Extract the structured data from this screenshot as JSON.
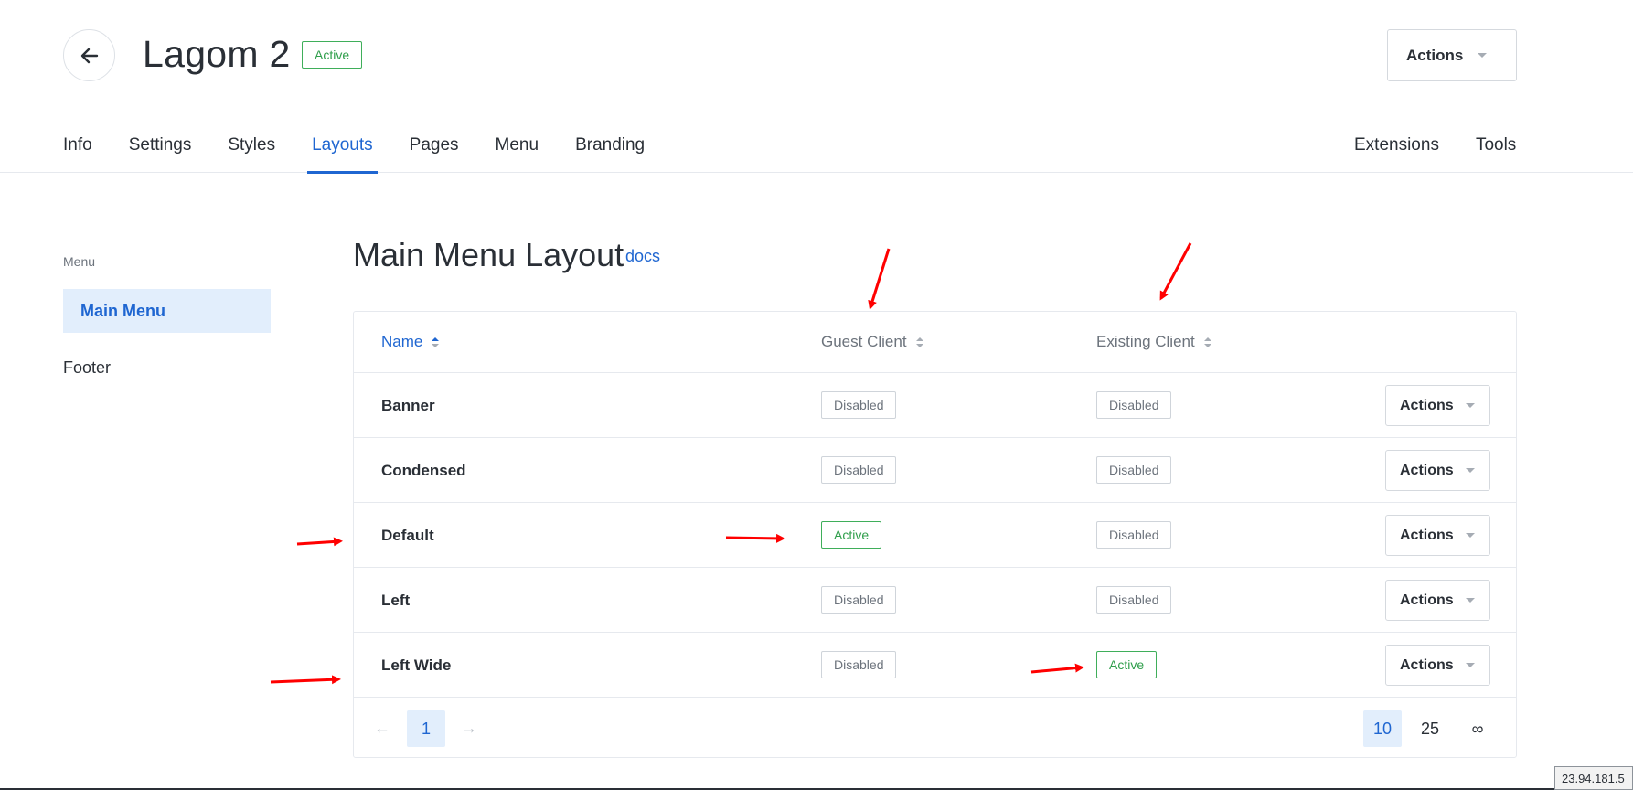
{
  "header": {
    "title": "Lagom 2",
    "status": "Active",
    "actions_label": "Actions"
  },
  "tabs": {
    "left": [
      "Info",
      "Settings",
      "Styles",
      "Layouts",
      "Pages",
      "Menu",
      "Branding"
    ],
    "right": [
      "Extensions",
      "Tools"
    ],
    "active": "Layouts"
  },
  "sidebar": {
    "section_label": "Menu",
    "items": [
      {
        "label": "Main Menu",
        "active": true
      },
      {
        "label": "Footer",
        "active": false
      }
    ]
  },
  "main": {
    "title": "Main Menu Layout",
    "docs_label": "docs"
  },
  "table": {
    "columns": [
      "Name",
      "Guest Client",
      "Existing Client"
    ],
    "sorted_column": "Name",
    "rows": [
      {
        "name": "Banner",
        "guest": "Disabled",
        "existing": "Disabled",
        "actions": "Actions"
      },
      {
        "name": "Condensed",
        "guest": "Disabled",
        "existing": "Disabled",
        "actions": "Actions"
      },
      {
        "name": "Default",
        "guest": "Active",
        "existing": "Disabled",
        "actions": "Actions"
      },
      {
        "name": "Left",
        "guest": "Disabled",
        "existing": "Disabled",
        "actions": "Actions"
      },
      {
        "name": "Left Wide",
        "guest": "Disabled",
        "existing": "Active",
        "actions": "Actions"
      }
    ]
  },
  "pagination": {
    "prev_label": "←",
    "next_label": "→",
    "current_page": "1",
    "page_sizes": [
      "10",
      "25",
      "∞"
    ],
    "selected_page_size": "10"
  },
  "overlay": {
    "ip_text": "23.94.181.5"
  },
  "colors": {
    "accent": "#1f66d1",
    "active_green": "#2f9e4b",
    "annotation_red": "#ff0000",
    "selected_bg": "#e2eefc"
  }
}
